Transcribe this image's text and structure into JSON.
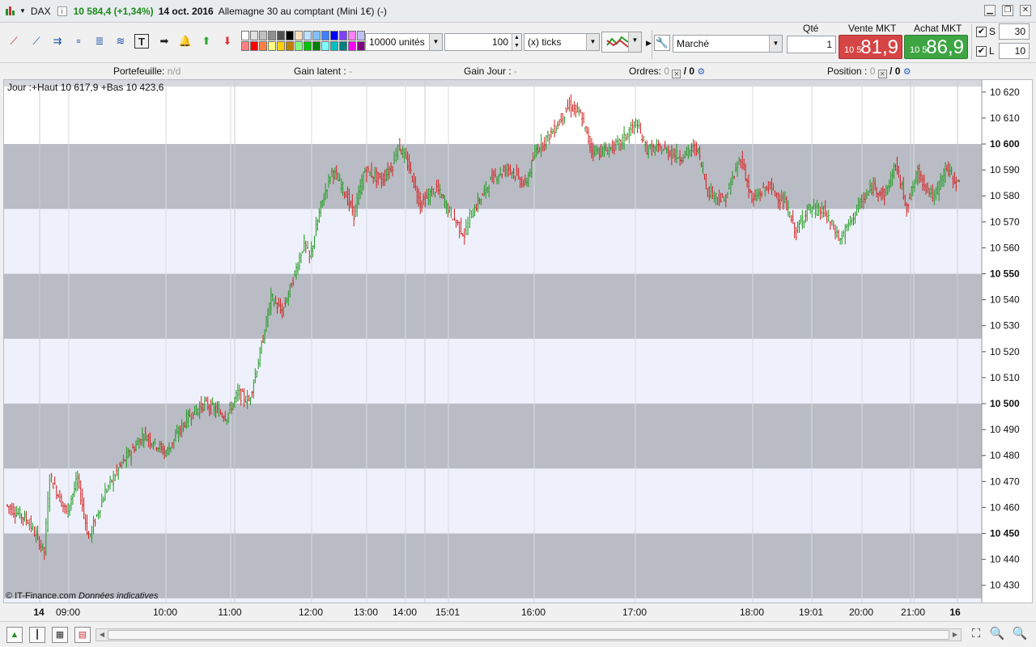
{
  "window": {
    "symbol": "DAX",
    "price": "10 584,4 (+1,34%)",
    "date": "14 oct. 2016",
    "description": "Allemagne 30 au comptant (Mini 1€) (-)",
    "info_label": "i"
  },
  "toolbar": {
    "units_select": "10000 unités",
    "quantity": "100",
    "ticks_select": "(x) ticks",
    "order_type": "Marché",
    "qty_label": "Qté",
    "qty_value": "1",
    "sell_label": "Vente MKT",
    "sell_prefix": "10 5",
    "sell_price": "81,9",
    "buy_label": "Achat MKT",
    "buy_prefix": "10 5",
    "buy_price": "86,9",
    "stop_label": "S",
    "stop_value": "30",
    "limit_label": "L",
    "limit_value": "10",
    "palette_colors": [
      "#ffffff",
      "#e0e0e0",
      "#c0c0c0",
      "#909090",
      "#505050",
      "#000000",
      "#ffe0c0",
      "#c0e0ff",
      "#80c0ff",
      "#4080ff",
      "#0000ff",
      "#8040ff",
      "#ff80ff",
      "#c0c0ff",
      "#ff8080",
      "#ff0000",
      "#ff8040",
      "#ffff80",
      "#ffd000",
      "#c08000",
      "#80ff80",
      "#00c000",
      "#008000",
      "#80ffff",
      "#00c0c0",
      "#008080",
      "#ff00ff",
      "#800080"
    ]
  },
  "portfolio": {
    "portefeuille_label": "Portefeuille:",
    "portefeuille_value": "n/d",
    "gain_latent_label": "Gain latent :",
    "gain_latent_value": "-",
    "gain_jour_label": "Gain Jour :",
    "gain_jour_value": "-",
    "ordres_label": "Ordres:",
    "ordres_a": "0",
    "ordres_b": "/ 0",
    "position_label": "Position :",
    "position_a": "0",
    "position_b": "/ 0"
  },
  "chart": {
    "legend": "Jour :+Haut 10 617,9 +Bas 10 423,6",
    "credit": "© IT-Finance.com",
    "credit_note": "Données indicatives"
  },
  "chart_data": {
    "type": "line",
    "style": "ohlc-bars",
    "title": "",
    "ylim": [
      10424,
      10624
    ],
    "yticks": [
      10430,
      10440,
      10450,
      10460,
      10470,
      10480,
      10490,
      10500,
      10510,
      10520,
      10530,
      10540,
      10550,
      10560,
      10570,
      10580,
      10590,
      10600,
      10610,
      10620
    ],
    "bold_yticks": [
      10450,
      10500,
      10550,
      10600
    ],
    "bands": [
      [
        10425,
        10450
      ],
      [
        10475,
        10500
      ],
      [
        10525,
        10550
      ],
      [
        10575,
        10600
      ]
    ],
    "day_high": 10617.9,
    "day_low": 10423.6,
    "last": 10584.4,
    "x_ticks": [
      {
        "label": "14",
        "day": true
      },
      {
        "label": "09:00"
      },
      {
        "label": "10:00"
      },
      {
        "label": "11:00"
      },
      {
        "label": "12:00"
      },
      {
        "label": "13:00"
      },
      {
        "label": "14:00"
      },
      {
        "label": "15:01"
      },
      {
        "label": "16:00"
      },
      {
        "label": "17:00"
      },
      {
        "label": "18:00"
      },
      {
        "label": "19:01"
      },
      {
        "label": "20:00"
      },
      {
        "label": "21:00"
      },
      {
        "label": "16",
        "day": true
      }
    ],
    "path_points": [
      [
        0,
        10461
      ],
      [
        8,
        10455
      ],
      [
        14,
        10443
      ],
      [
        16,
        10472
      ],
      [
        22,
        10458
      ],
      [
        26,
        10471
      ],
      [
        30,
        10448
      ],
      [
        36,
        10466
      ],
      [
        42,
        10477
      ],
      [
        50,
        10488
      ],
      [
        58,
        10481
      ],
      [
        66,
        10495
      ],
      [
        72,
        10500
      ],
      [
        80,
        10495
      ],
      [
        84,
        10504
      ],
      [
        88,
        10501
      ],
      [
        92,
        10519
      ],
      [
        96,
        10541
      ],
      [
        100,
        10535
      ],
      [
        104,
        10548
      ],
      [
        108,
        10562
      ],
      [
        110,
        10556
      ],
      [
        114,
        10576
      ],
      [
        118,
        10590
      ],
      [
        122,
        10583
      ],
      [
        126,
        10573
      ],
      [
        130,
        10590
      ],
      [
        136,
        10586
      ],
      [
        140,
        10592
      ],
      [
        142,
        10600
      ],
      [
        146,
        10591
      ],
      [
        150,
        10577
      ],
      [
        156,
        10583
      ],
      [
        160,
        10575
      ],
      [
        166,
        10565
      ],
      [
        168,
        10572
      ],
      [
        176,
        10587
      ],
      [
        182,
        10591
      ],
      [
        188,
        10584
      ],
      [
        192,
        10598
      ],
      [
        198,
        10605
      ],
      [
        204,
        10615
      ],
      [
        208,
        10611
      ],
      [
        212,
        10598
      ],
      [
        216,
        10597
      ],
      [
        222,
        10600
      ],
      [
        228,
        10608
      ],
      [
        232,
        10598
      ],
      [
        238,
        10598
      ],
      [
        244,
        10595
      ],
      [
        250,
        10599
      ],
      [
        254,
        10582
      ],
      [
        260,
        10578
      ],
      [
        266,
        10595
      ],
      [
        270,
        10578
      ],
      [
        276,
        10584
      ],
      [
        282,
        10577
      ],
      [
        286,
        10566
      ],
      [
        290,
        10575
      ],
      [
        296,
        10574
      ],
      [
        302,
        10563
      ],
      [
        308,
        10575
      ],
      [
        314,
        10584
      ],
      [
        318,
        10580
      ],
      [
        322,
        10592
      ],
      [
        326,
        10576
      ],
      [
        330,
        10589
      ],
      [
        336,
        10579
      ],
      [
        340,
        10591
      ],
      [
        345,
        10584
      ]
    ]
  },
  "bottom": {
    "icons": [
      "chart-type",
      "candles",
      "table",
      "grid",
      "range"
    ]
  }
}
